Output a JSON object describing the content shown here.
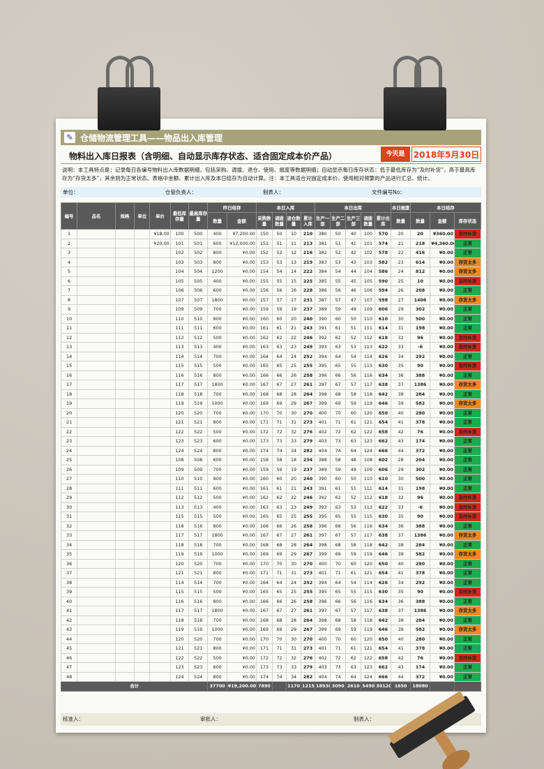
{
  "app_title": "仓储物流管理工具——物品出入库管理",
  "report_title": "物料出入库日报表（含明细、自动显示库存状态、适合固定成本价产品）",
  "today_label": "今天是",
  "today_date": "2018年5月30日",
  "description": "说明：本工具特点是：记录每日各编号物料出入库数据明细，包括采购、调拨、退仓、使用、报废等数据明细；自动显示每日库存状态：低于最低库存为“及时补货”，高于最高库存为“存货太多”，其余则为正常状态。表格中金额、累计出入库及本日结存为自动计算。注：本工具适合对固定成本价、使用相对频繁的产品进行汇总、统计。",
  "info": {
    "unit": "单位：",
    "keeper": "仓管负责人：",
    "maker": "制表人：",
    "doc_no": "文件编号No："
  },
  "headers": {
    "no": "编号",
    "name": "品名",
    "spec": "规格",
    "unit": "单位",
    "price": "单价",
    "min": "最低库存量",
    "max": "最高库存量",
    "prev": "昨日结存",
    "in": "本日入库",
    "out": "本日出库",
    "scrap": "本日报废",
    "cur": "本日结存",
    "qty": "数量",
    "amt": "金额",
    "buy": "采购数量",
    "trans": "调拨数量",
    "ret": "退仓数量",
    "cum_in": "累计入库",
    "p1": "生产一部",
    "p2": "生产二部",
    "p3": "生产三部",
    "tout": "调拨数量",
    "cum_out": "累计出库",
    "status": "库存状态"
  },
  "status_colors": {
    "正常": "#1eab4f",
    "存货太多": "#f08a1c",
    "及时补货": "#d0271d"
  },
  "rows": [
    [
      "1",
      "",
      "",
      "",
      "¥18.00",
      "100",
      "500",
      "400",
      "¥7,200.00",
      "150",
      "50",
      "10",
      "210",
      "380",
      "50",
      "40",
      "100",
      "570",
      "20",
      "20",
      "¥360.00",
      "及时补货"
    ],
    [
      "2",
      "",
      "",
      "",
      "¥20.00",
      "101",
      "501",
      "600",
      "¥12,000.00",
      "151",
      "51",
      "11",
      "213",
      "381",
      "51",
      "41",
      "101",
      "574",
      "21",
      "218",
      "¥4,360.00",
      "正常"
    ],
    [
      "3",
      "",
      "",
      "",
      "",
      "102",
      "502",
      "800",
      "¥0.00",
      "152",
      "52",
      "12",
      "216",
      "382",
      "52",
      "42",
      "102",
      "578",
      "22",
      "416",
      "¥0.00",
      "正常"
    ],
    [
      "4",
      "",
      "",
      "",
      "",
      "103",
      "503",
      "800",
      "¥0.00",
      "153",
      "53",
      "13",
      "219",
      "383",
      "53",
      "43",
      "103",
      "582",
      "23",
      "614",
      "¥0.00",
      "存货太多"
    ],
    [
      "5",
      "",
      "",
      "",
      "",
      "104",
      "504",
      "1200",
      "¥0.00",
      "154",
      "54",
      "14",
      "222",
      "384",
      "54",
      "44",
      "104",
      "586",
      "24",
      "812",
      "¥0.00",
      "存货太多"
    ],
    [
      "6",
      "",
      "",
      "",
      "",
      "105",
      "505",
      "400",
      "¥0.00",
      "155",
      "55",
      "15",
      "225",
      "385",
      "55",
      "45",
      "105",
      "590",
      "25",
      "10",
      "¥0.00",
      "及时补货"
    ],
    [
      "7",
      "",
      "",
      "",
      "",
      "106",
      "506",
      "600",
      "¥0.00",
      "156",
      "56",
      "16",
      "228",
      "386",
      "56",
      "46",
      "106",
      "594",
      "26",
      "208",
      "¥0.00",
      "正常"
    ],
    [
      "8",
      "",
      "",
      "",
      "",
      "107",
      "507",
      "1800",
      "¥0.00",
      "157",
      "57",
      "17",
      "231",
      "387",
      "57",
      "47",
      "107",
      "598",
      "27",
      "1406",
      "¥0.00",
      "存货太多"
    ],
    [
      "9",
      "",
      "",
      "",
      "",
      "109",
      "509",
      "700",
      "¥0.00",
      "159",
      "59",
      "19",
      "237",
      "389",
      "59",
      "49",
      "109",
      "606",
      "29",
      "302",
      "¥0.00",
      "正常"
    ],
    [
      "10",
      "",
      "",
      "",
      "",
      "110",
      "510",
      "900",
      "¥0.00",
      "160",
      "60",
      "20",
      "240",
      "390",
      "60",
      "50",
      "110",
      "610",
      "30",
      "500",
      "¥0.00",
      "正常"
    ],
    [
      "11",
      "",
      "",
      "",
      "",
      "111",
      "511",
      "600",
      "¥0.00",
      "161",
      "61",
      "21",
      "243",
      "391",
      "61",
      "51",
      "111",
      "614",
      "31",
      "198",
      "¥0.00",
      "正常"
    ],
    [
      "12",
      "",
      "",
      "",
      "",
      "112",
      "512",
      "500",
      "¥0.00",
      "162",
      "62",
      "22",
      "246",
      "392",
      "62",
      "52",
      "112",
      "618",
      "32",
      "96",
      "¥0.00",
      "及时补货"
    ],
    [
      "13",
      "",
      "",
      "",
      "",
      "113",
      "513",
      "400",
      "¥0.00",
      "163",
      "63",
      "23",
      "249",
      "393",
      "63",
      "53",
      "113",
      "622",
      "33",
      "-6",
      "¥0.00",
      "及时补货"
    ],
    [
      "14",
      "",
      "",
      "",
      "",
      "114",
      "514",
      "700",
      "¥0.00",
      "164",
      "64",
      "24",
      "252",
      "394",
      "64",
      "54",
      "114",
      "626",
      "34",
      "292",
      "¥0.00",
      "正常"
    ],
    [
      "15",
      "",
      "",
      "",
      "",
      "115",
      "515",
      "500",
      "¥0.00",
      "165",
      "65",
      "25",
      "255",
      "395",
      "65",
      "55",
      "115",
      "630",
      "35",
      "90",
      "¥0.00",
      "及时补货"
    ],
    [
      "16",
      "",
      "",
      "",
      "",
      "116",
      "516",
      "800",
      "¥0.00",
      "166",
      "66",
      "26",
      "258",
      "396",
      "66",
      "56",
      "116",
      "634",
      "36",
      "388",
      "¥0.00",
      "正常"
    ],
    [
      "17",
      "",
      "",
      "",
      "",
      "117",
      "517",
      "1800",
      "¥0.00",
      "167",
      "67",
      "27",
      "261",
      "397",
      "67",
      "57",
      "117",
      "638",
      "37",
      "1386",
      "¥0.00",
      "存货太多"
    ],
    [
      "18",
      "",
      "",
      "",
      "",
      "118",
      "518",
      "700",
      "¥0.00",
      "168",
      "68",
      "28",
      "264",
      "398",
      "68",
      "58",
      "118",
      "642",
      "38",
      "284",
      "¥0.00",
      "正常"
    ],
    [
      "19",
      "",
      "",
      "",
      "",
      "119",
      "519",
      "1000",
      "¥0.00",
      "169",
      "69",
      "29",
      "267",
      "399",
      "69",
      "59",
      "119",
      "646",
      "39",
      "582",
      "¥0.00",
      "存货太多"
    ],
    [
      "20",
      "",
      "",
      "",
      "",
      "120",
      "520",
      "700",
      "¥0.00",
      "170",
      "70",
      "30",
      "270",
      "400",
      "70",
      "60",
      "120",
      "650",
      "40",
      "280",
      "¥0.00",
      "正常"
    ],
    [
      "21",
      "",
      "",
      "",
      "",
      "121",
      "521",
      "800",
      "¥0.00",
      "171",
      "71",
      "31",
      "273",
      "401",
      "71",
      "61",
      "121",
      "654",
      "41",
      "378",
      "¥0.00",
      "正常"
    ],
    [
      "22",
      "",
      "",
      "",
      "",
      "122",
      "522",
      "500",
      "¥0.00",
      "172",
      "72",
      "32",
      "276",
      "402",
      "72",
      "62",
      "122",
      "658",
      "42",
      "76",
      "¥0.00",
      "及时补货"
    ],
    [
      "23",
      "",
      "",
      "",
      "",
      "123",
      "523",
      "600",
      "¥0.00",
      "173",
      "73",
      "33",
      "279",
      "403",
      "73",
      "63",
      "123",
      "662",
      "43",
      "174",
      "¥0.00",
      "正常"
    ],
    [
      "24",
      "",
      "",
      "",
      "",
      "124",
      "524",
      "800",
      "¥0.00",
      "174",
      "74",
      "34",
      "282",
      "404",
      "74",
      "64",
      "124",
      "666",
      "44",
      "372",
      "¥0.00",
      "正常"
    ],
    [
      "25",
      "",
      "",
      "",
      "",
      "108",
      "508",
      "600",
      "¥0.00",
      "158",
      "58",
      "18",
      "234",
      "388",
      "58",
      "48",
      "108",
      "602",
      "28",
      "204",
      "¥0.00",
      "正常"
    ],
    [
      "26",
      "",
      "",
      "",
      "",
      "109",
      "509",
      "700",
      "¥0.00",
      "159",
      "59",
      "19",
      "237",
      "389",
      "59",
      "49",
      "109",
      "606",
      "29",
      "302",
      "¥0.00",
      "正常"
    ],
    [
      "27",
      "",
      "",
      "",
      "",
      "110",
      "510",
      "900",
      "¥0.00",
      "160",
      "60",
      "20",
      "240",
      "390",
      "60",
      "50",
      "110",
      "610",
      "30",
      "500",
      "¥0.00",
      "正常"
    ],
    [
      "28",
      "",
      "",
      "",
      "",
      "111",
      "511",
      "600",
      "¥0.00",
      "161",
      "61",
      "21",
      "243",
      "391",
      "61",
      "51",
      "111",
      "614",
      "31",
      "198",
      "¥0.00",
      "正常"
    ],
    [
      "29",
      "",
      "",
      "",
      "",
      "112",
      "512",
      "500",
      "¥0.00",
      "162",
      "62",
      "22",
      "246",
      "392",
      "62",
      "52",
      "112",
      "618",
      "32",
      "96",
      "¥0.00",
      "及时补货"
    ],
    [
      "30",
      "",
      "",
      "",
      "",
      "113",
      "513",
      "400",
      "¥0.00",
      "163",
      "63",
      "23",
      "249",
      "393",
      "63",
      "53",
      "113",
      "622",
      "33",
      "-6",
      "¥0.00",
      "及时补货"
    ],
    [
      "31",
      "",
      "",
      "",
      "",
      "115",
      "515",
      "500",
      "¥0.00",
      "165",
      "65",
      "25",
      "255",
      "395",
      "65",
      "55",
      "115",
      "630",
      "35",
      "90",
      "¥0.00",
      "及时补货"
    ],
    [
      "32",
      "",
      "",
      "",
      "",
      "116",
      "516",
      "800",
      "¥0.00",
      "166",
      "66",
      "26",
      "258",
      "396",
      "66",
      "56",
      "116",
      "634",
      "36",
      "388",
      "¥0.00",
      "正常"
    ],
    [
      "33",
      "",
      "",
      "",
      "",
      "117",
      "517",
      "1800",
      "¥0.00",
      "167",
      "67",
      "27",
      "261",
      "397",
      "67",
      "57",
      "117",
      "638",
      "37",
      "1386",
      "¥0.00",
      "存货太多"
    ],
    [
      "34",
      "",
      "",
      "",
      "",
      "118",
      "518",
      "700",
      "¥0.00",
      "168",
      "68",
      "28",
      "264",
      "398",
      "68",
      "58",
      "118",
      "642",
      "38",
      "284",
      "¥0.00",
      "正常"
    ],
    [
      "35",
      "",
      "",
      "",
      "",
      "119",
      "519",
      "1000",
      "¥0.00",
      "169",
      "69",
      "29",
      "267",
      "399",
      "69",
      "59",
      "119",
      "646",
      "39",
      "582",
      "¥0.00",
      "存货太多"
    ],
    [
      "36",
      "",
      "",
      "",
      "",
      "120",
      "520",
      "700",
      "¥0.00",
      "170",
      "70",
      "30",
      "270",
      "400",
      "70",
      "60",
      "120",
      "650",
      "40",
      "280",
      "¥0.00",
      "正常"
    ],
    [
      "37",
      "",
      "",
      "",
      "",
      "121",
      "521",
      "800",
      "¥0.00",
      "171",
      "71",
      "31",
      "273",
      "401",
      "71",
      "61",
      "121",
      "654",
      "41",
      "378",
      "¥0.00",
      "正常"
    ],
    [
      "38",
      "",
      "",
      "",
      "",
      "114",
      "514",
      "700",
      "¥0.00",
      "164",
      "64",
      "24",
      "252",
      "394",
      "64",
      "54",
      "114",
      "626",
      "34",
      "292",
      "¥0.00",
      "正常"
    ],
    [
      "39",
      "",
      "",
      "",
      "",
      "115",
      "515",
      "500",
      "¥0.00",
      "165",
      "65",
      "25",
      "255",
      "395",
      "65",
      "55",
      "115",
      "630",
      "35",
      "90",
      "¥0.00",
      "及时补货"
    ],
    [
      "40",
      "",
      "",
      "",
      "",
      "116",
      "516",
      "800",
      "¥0.00",
      "166",
      "66",
      "26",
      "258",
      "396",
      "66",
      "56",
      "116",
      "634",
      "36",
      "388",
      "¥0.00",
      "正常"
    ],
    [
      "41",
      "",
      "",
      "",
      "",
      "117",
      "517",
      "1800",
      "¥0.00",
      "167",
      "67",
      "27",
      "261",
      "397",
      "67",
      "57",
      "117",
      "638",
      "37",
      "1386",
      "¥0.00",
      "存货太多"
    ],
    [
      "42",
      "",
      "",
      "",
      "",
      "118",
      "518",
      "700",
      "¥0.00",
      "168",
      "68",
      "28",
      "264",
      "398",
      "68",
      "58",
      "118",
      "642",
      "38",
      "284",
      "¥0.00",
      "正常"
    ],
    [
      "43",
      "",
      "",
      "",
      "",
      "119",
      "519",
      "1000",
      "¥0.00",
      "169",
      "69",
      "29",
      "267",
      "399",
      "69",
      "59",
      "119",
      "646",
      "39",
      "582",
      "¥0.00",
      "存货太多"
    ],
    [
      "44",
      "",
      "",
      "",
      "",
      "120",
      "520",
      "700",
      "¥0.00",
      "170",
      "70",
      "30",
      "270",
      "400",
      "70",
      "60",
      "120",
      "650",
      "40",
      "280",
      "¥0.00",
      "正常"
    ],
    [
      "45",
      "",
      "",
      "",
      "",
      "121",
      "521",
      "800",
      "¥0.00",
      "171",
      "71",
      "31",
      "273",
      "401",
      "71",
      "61",
      "121",
      "654",
      "41",
      "378",
      "¥0.00",
      "正常"
    ],
    [
      "46",
      "",
      "",
      "",
      "",
      "122",
      "522",
      "500",
      "¥0.00",
      "172",
      "72",
      "32",
      "276",
      "402",
      "72",
      "62",
      "122",
      "658",
      "42",
      "76",
      "¥0.00",
      "及时补货"
    ],
    [
      "47",
      "",
      "",
      "",
      "",
      "123",
      "523",
      "600",
      "¥0.00",
      "173",
      "73",
      "33",
      "279",
      "403",
      "73",
      "63",
      "123",
      "662",
      "43",
      "174",
      "¥0.00",
      "正常"
    ],
    [
      "48",
      "",
      "",
      "",
      "",
      "124",
      "524",
      "800",
      "¥0.00",
      "174",
      "74",
      "34",
      "282",
      "404",
      "74",
      "64",
      "124",
      "666",
      "44",
      "372",
      "¥0.00",
      "正常"
    ]
  ],
  "total": {
    "label": "合计",
    "prev_qty": "37700",
    "prev_amt": "¥19,200.00",
    "buy": "7890",
    "ret": "1170",
    "cum_in": "12150",
    "p1": "18930",
    "p2": "3090",
    "p3": "2610",
    "tout": "5490",
    "cum_out": "30120",
    "scrap": "1650",
    "cur_qty": "18080"
  },
  "footer": {
    "check": "核准人：",
    "approve": "审批人：",
    "maker": "制表人："
  }
}
